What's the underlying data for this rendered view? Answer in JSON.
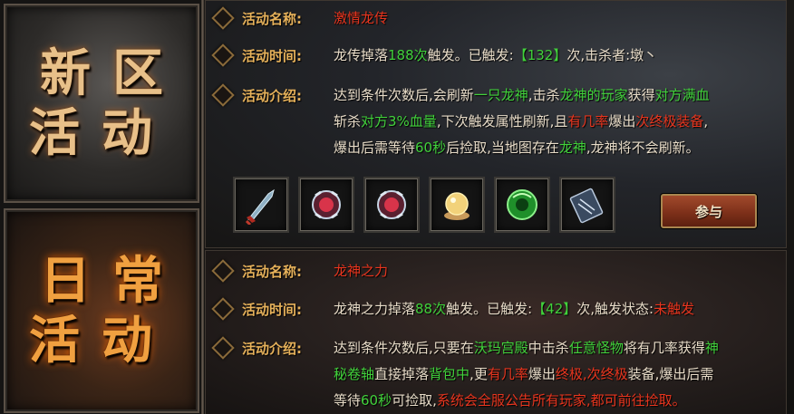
{
  "tabs": {
    "new_server": "新区活动",
    "daily": "日常活动"
  },
  "labels": {
    "name": "活动名称:",
    "time": "活动时间:",
    "intro": "活动介绍:"
  },
  "event1": {
    "name": "激情龙传",
    "time_parts": [
      "龙传掉落",
      "188次",
      "触发。已触发:",
      "【132】",
      "次,击杀者:墩丶"
    ],
    "intro_line1": [
      "达到条件次数后,会刷新",
      "一只龙神",
      ",击杀",
      "龙神的玩家",
      "获得",
      "对方满血"
    ],
    "intro_line2": [
      "斩杀",
      "对方3%血量",
      ",下次触发属性刷新,且",
      "有几率",
      "爆出",
      "次终极装备",
      ","
    ],
    "intro_line3": [
      "爆出后需等待",
      "60秒",
      "后捡取,当地图存在",
      "龙神",
      ",龙神将不会刷新。"
    ],
    "rewards": [
      "blade-icon",
      "blood-jade-icon",
      "blood-jade-icon",
      "pearl-icon",
      "green-jade-icon",
      "scroll-book-icon"
    ],
    "join_button": "参与"
  },
  "event2": {
    "name": "龙神之力",
    "time_parts": [
      "龙神之力掉落",
      "88次",
      "触发。已触发:",
      "【42】",
      "次,触发状态:",
      "未触发"
    ],
    "intro_line1": [
      "达到条件次数后,只要在",
      "沃玛宫殿",
      "中击杀",
      "任意怪物",
      "将有几率获得",
      "神"
    ],
    "intro_line2": [
      "秘卷轴",
      "直接掉落",
      "背包中",
      ",更",
      "有几率",
      "爆出",
      "终极,次终极",
      "装备,爆出后需"
    ],
    "intro_line3": [
      "等待",
      "60秒",
      "可捡取,",
      "系统会全服公告所有玩家,都可前往捡取。"
    ]
  }
}
